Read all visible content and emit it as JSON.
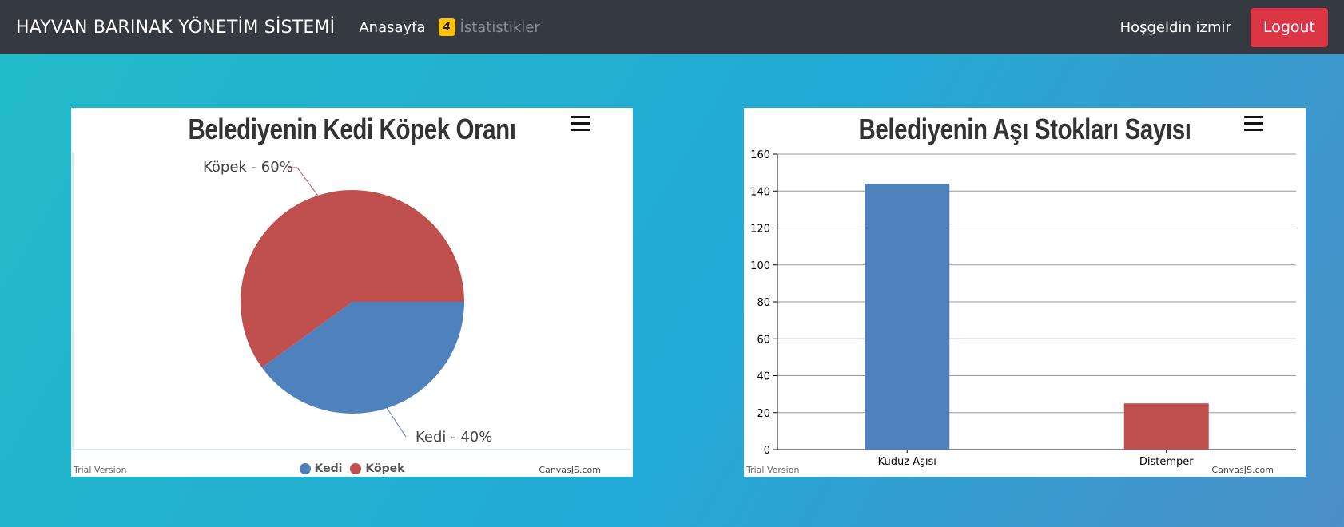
{
  "navbar": {
    "brand": "HAYVAN BARINAK YÖNETİM SİSTEMİ",
    "home_label": "Anasayfa",
    "badge_count": "4",
    "stats_label": "İstatistikler",
    "welcome": "Hoşgeldin izmir",
    "logout_label": "Logout"
  },
  "charts": {
    "pie": {
      "title": "Belediyenin Kedi Köpek Oranı",
      "trial": "Trial Version",
      "credit": "CanvasJS.com",
      "label_kopek": "Köpek - 60%",
      "label_kedi": "Kedi - 40%",
      "legend_kedi": "Kedi",
      "legend_kopek": "Köpek"
    },
    "bar": {
      "title": "Belediyenin Aşı Stokları Sayısı",
      "trial": "Trial Version",
      "credit": "CanvasJS.com"
    }
  },
  "colors": {
    "kedi": "#4f81bd",
    "kopek": "#c0504d"
  },
  "chart_data": [
    {
      "type": "pie",
      "title": "Belediyenin Kedi Köpek Oranı",
      "categories": [
        "Kedi",
        "Köpek"
      ],
      "values": [
        40,
        60
      ],
      "labels": [
        "Kedi - 40%",
        "Köpek - 60%"
      ],
      "legend": "bottom"
    },
    {
      "type": "bar",
      "title": "Belediyenin Aşı Stokları Sayısı",
      "categories": [
        "Kuduz Aşısı",
        "Distemper"
      ],
      "values": [
        144,
        25
      ],
      "ylim": [
        0,
        160
      ],
      "yticks": [
        0,
        20,
        40,
        60,
        80,
        100,
        120,
        140,
        160
      ],
      "grid": true
    }
  ]
}
